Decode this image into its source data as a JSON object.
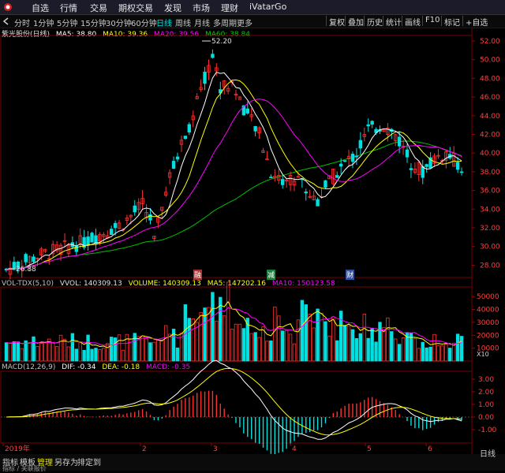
{
  "menu": {
    "items": [
      "自选",
      "行情",
      "交易",
      "期权交易",
      "发现",
      "市场",
      "理财",
      "iVatarGo"
    ]
  },
  "toolbar": {
    "periods": [
      "分时",
      "1分钟",
      "5分钟",
      "15分钟",
      "30分钟",
      "60分钟",
      "日线",
      "周线",
      "月线",
      "多周期",
      "更多"
    ],
    "active_period": "日线",
    "buttons": [
      "复权",
      "叠加",
      "历史",
      "统计",
      "画线",
      "F10",
      "标记",
      "+自选"
    ],
    "back_icon": "back-arrow-icon"
  },
  "main_chart": {
    "title": "紫光股份(日线)",
    "ma5": "MA5: 38.80",
    "ma10": "MA10: 39.36",
    "ma20": "MA20: 39.56",
    "ma60": "MA60: 38.84",
    "high_label": "52.20",
    "low_label": "26.88",
    "y_ticks": [
      "52.00",
      "50.00",
      "48.00",
      "46.00",
      "44.00",
      "42.00",
      "40.00",
      "38.00",
      "36.00",
      "34.00",
      "32.00",
      "30.00",
      "28.00"
    ],
    "badges": [
      "融",
      "减",
      "财"
    ],
    "colors": {
      "up": "#ff3030",
      "down": "#00e0e0",
      "ma5": "#ffffff",
      "ma10": "#ffff00",
      "ma20": "#ff00ff",
      "ma60": "#00c000"
    }
  },
  "volume_chart": {
    "indicator": "VOL-TDX(5,10)",
    "vvol": "VVOL: 140309.13",
    "volume": "VOLUME: 140309.13",
    "ma5": "MA5: 147202.16",
    "ma10": "MA10: 150123.58",
    "y_ticks": [
      "50000",
      "40000",
      "30000",
      "20000",
      "10000"
    ],
    "unit": "X10"
  },
  "macd_chart": {
    "indicator": "MACD(12,26,9)",
    "dif": "DIF: -0.34",
    "dea": "DEA: -0.18",
    "macd": "MACD: -0.35",
    "y_ticks": [
      "3.00",
      "2.00",
      "1.00",
      "0.00",
      "-1.00"
    ]
  },
  "x_axis": {
    "labels": [
      "2019年",
      "2",
      "3",
      "4",
      "5",
      "6"
    ],
    "right_label": "日线"
  },
  "bottom_tabs": [
    "指标",
    "模板",
    "管理",
    "另存为",
    "排定到"
  ],
  "bottom_active": "管理",
  "bottom_row2": "指标 / 关联报价"
}
